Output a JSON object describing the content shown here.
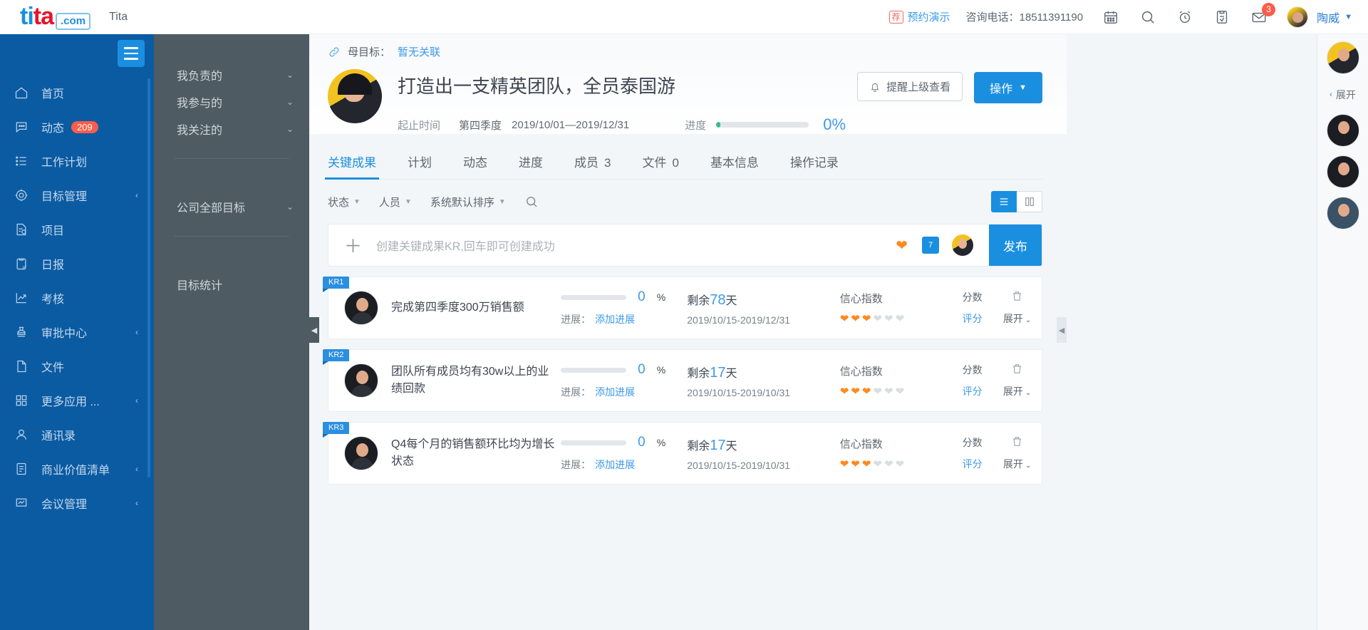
{
  "brand": {
    "logo_ti": "ti",
    "logo_ta": "ta",
    "logo_com": ".com",
    "sub": "Tita"
  },
  "topbar": {
    "promo_tag": "荐",
    "promo_link": "预约演示",
    "phone_label": "咨询电话：18511391190",
    "icons": [
      {
        "name": "calendar-icon"
      },
      {
        "name": "search-icon"
      },
      {
        "name": "alarm-clock-icon"
      },
      {
        "name": "clipboard-task-icon"
      },
      {
        "name": "mail-icon",
        "badge": "3"
      }
    ],
    "mail_badge": "3",
    "user_name": "陶威",
    "caret": "▼"
  },
  "sidebar": {
    "items": [
      {
        "label": "首页",
        "icon": "home-icon",
        "badge": "",
        "chevron": ""
      },
      {
        "label": "动态",
        "icon": "chat-bubble-icon",
        "badge": "209",
        "chevron": ""
      },
      {
        "label": "工作计划",
        "icon": "task-list-icon",
        "badge": "",
        "chevron": ""
      },
      {
        "label": "目标管理",
        "icon": "target-icon",
        "badge": "",
        "chevron": "‹"
      },
      {
        "label": "项目",
        "icon": "project-icon",
        "badge": "",
        "chevron": ""
      },
      {
        "label": "日报",
        "icon": "report-icon",
        "badge": "",
        "chevron": ""
      },
      {
        "label": "考核",
        "icon": "assessment-icon",
        "badge": "",
        "chevron": ""
      },
      {
        "label": "审批中心",
        "icon": "approval-stamp-icon",
        "badge": "",
        "chevron": "‹"
      },
      {
        "label": "文件",
        "icon": "file-icon",
        "badge": "",
        "chevron": ""
      },
      {
        "label": "更多应用 ...",
        "icon": "grid-apps-icon",
        "badge": "",
        "chevron": "‹"
      },
      {
        "label": "通讯录",
        "icon": "contacts-icon",
        "badge": "",
        "chevron": ""
      },
      {
        "label": "商业价值清单",
        "icon": "value-list-icon",
        "badge": "",
        "chevron": "‹"
      },
      {
        "label": "会议管理",
        "icon": "meeting-icon",
        "badge": "",
        "chevron": "‹"
      }
    ],
    "collapse_arrow": "‹"
  },
  "panel2": {
    "items": [
      {
        "label": "我负责的",
        "chevron": "⌄"
      },
      {
        "label": "我参与的",
        "chevron": "⌄"
      },
      {
        "label": "我关注的",
        "chevron": "⌄"
      }
    ],
    "company": {
      "label": "公司全部目标",
      "chevron": "⌄"
    },
    "stats": {
      "label": "目标统计"
    }
  },
  "handles": {
    "left": "◀",
    "right": "◀"
  },
  "goal": {
    "parent_label": "母目标：",
    "parent_value": "暂无关联",
    "title": "打造出一支精英团队，全员泰国游",
    "period_label": "起止时间",
    "quarter": "第四季度",
    "date_range": "2019/10/01—2019/12/31",
    "progress_label": "进度",
    "progress_pct": "0%",
    "progress_value": 0,
    "btn_remind": "提醒上级查看",
    "btn_action": "操作",
    "btn_action_caret": "▼"
  },
  "tabs": [
    {
      "label": "关键成果",
      "count": "",
      "active": true
    },
    {
      "label": "计划",
      "count": "",
      "active": false
    },
    {
      "label": "动态",
      "count": "",
      "active": false
    },
    {
      "label": "进度",
      "count": "",
      "active": false
    },
    {
      "label": "成员",
      "count": "3",
      "active": false
    },
    {
      "label": "文件",
      "count": "0",
      "active": false
    },
    {
      "label": "基本信息",
      "count": "",
      "active": false
    },
    {
      "label": "操作记录",
      "count": "",
      "active": false
    }
  ],
  "filters": {
    "status": "状态",
    "people": "人员",
    "sort": "系统默认排序",
    "caret": "▼",
    "search_icon": "search-icon",
    "view_list": "list-view-icon",
    "view_card": "card-view-icon"
  },
  "kr_create": {
    "plus": "＋",
    "placeholder": "创建关键成果KR,回车即可创建成功",
    "heart_icon": "heart-icon",
    "calendar_day": "7",
    "publish": "发布"
  },
  "kr_rows": [
    {
      "flag": "KR1",
      "name": "完成第四季度300万销售额",
      "percent": "0",
      "percent_sign": "%",
      "progress_label": "进展：",
      "progress_link": "添加进展",
      "remain_prefix": "剩余",
      "remain_days": "78",
      "remain_suffix": "天",
      "date_range": "2019/10/15-2019/12/31",
      "confidence_label": "信心指数",
      "hearts_on": 3,
      "hearts_total": 6,
      "score_label": "分数",
      "score_link": "评分",
      "delete_icon": "trash-icon",
      "expand_label": "展开",
      "expand_caret": "⌄"
    },
    {
      "flag": "KR2",
      "name": "团队所有成员均有30w以上的业绩回款",
      "percent": "0",
      "percent_sign": "%",
      "progress_label": "进展：",
      "progress_link": "添加进展",
      "remain_prefix": "剩余",
      "remain_days": "17",
      "remain_suffix": "天",
      "date_range": "2019/10/15-2019/10/31",
      "confidence_label": "信心指数",
      "hearts_on": 3,
      "hearts_total": 6,
      "score_label": "分数",
      "score_link": "评分",
      "delete_icon": "trash-icon",
      "expand_label": "展开",
      "expand_caret": "⌄"
    },
    {
      "flag": "KR3",
      "name": "Q4每个月的销售额环比均为增长状态",
      "percent": "0",
      "percent_sign": "%",
      "progress_label": "进展：",
      "progress_link": "添加进展",
      "remain_prefix": "剩余",
      "remain_days": "17",
      "remain_suffix": "天",
      "date_range": "2019/10/15-2019/10/31",
      "confidence_label": "信心指数",
      "hearts_on": 3,
      "hearts_total": 6,
      "score_label": "分数",
      "score_link": "评分",
      "delete_icon": "trash-icon",
      "expand_label": "展开",
      "expand_caret": "⌄"
    }
  ],
  "rail": {
    "expand_label": "展开",
    "expand_caret": "‹",
    "avatars": [
      "avatar-1",
      "avatar-2",
      "avatar-3",
      "avatar-4"
    ]
  },
  "colors": {
    "brand_blue": "#1a8fe0",
    "sidebar_blue": "#0b5ba3",
    "panel_gray": "#4e5b63",
    "accent_orange": "#ff8a1e",
    "badge_red": "#fa5d4b",
    "progress_green": "#3fb98a"
  }
}
